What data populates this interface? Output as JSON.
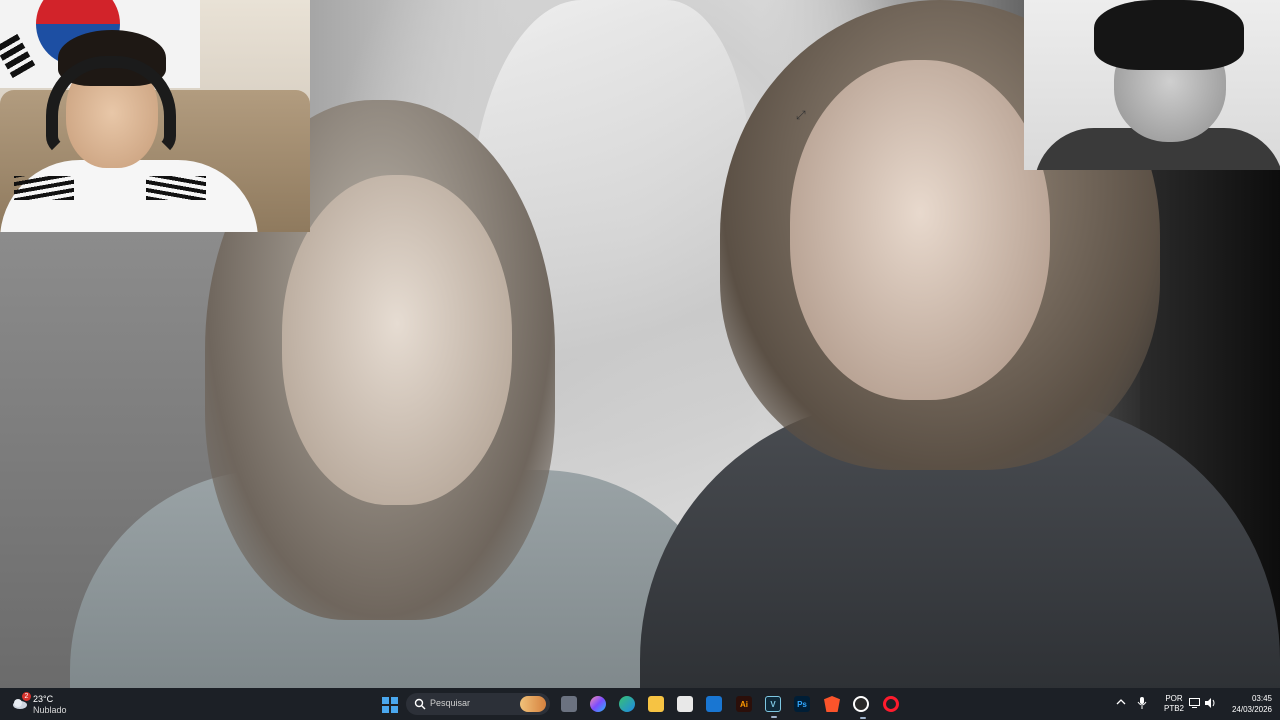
{
  "video": {
    "description_icon": "resize-cursor-icon"
  },
  "taskbar": {
    "weather": {
      "temperature": "23°C",
      "condition": "Nublado",
      "badge_count": "2",
      "icon": "cloud-weather-icon"
    },
    "search": {
      "placeholder": "Pesquisar",
      "icon": "search-icon"
    },
    "pinned_apps": [
      {
        "name": "task-view",
        "label": ""
      },
      {
        "name": "copilot",
        "label": ""
      },
      {
        "name": "edge",
        "label": ""
      },
      {
        "name": "file-explorer",
        "label": ""
      },
      {
        "name": "microsoft-store",
        "label": ""
      },
      {
        "name": "outlook",
        "label": ""
      },
      {
        "name": "illustrator",
        "label": "Ai"
      },
      {
        "name": "vegas",
        "label": "V"
      },
      {
        "name": "photoshop",
        "label": "Ps"
      },
      {
        "name": "brave",
        "label": ""
      },
      {
        "name": "obs",
        "label": ""
      },
      {
        "name": "opera",
        "label": ""
      }
    ],
    "tray": {
      "language_line1": "POR",
      "language_line2": "PTB2",
      "time": "03:45",
      "date": "24/03/2026"
    }
  },
  "colors": {
    "taskbar_bg": "#1c2026",
    "accent_blue": "#4aa7ee"
  }
}
